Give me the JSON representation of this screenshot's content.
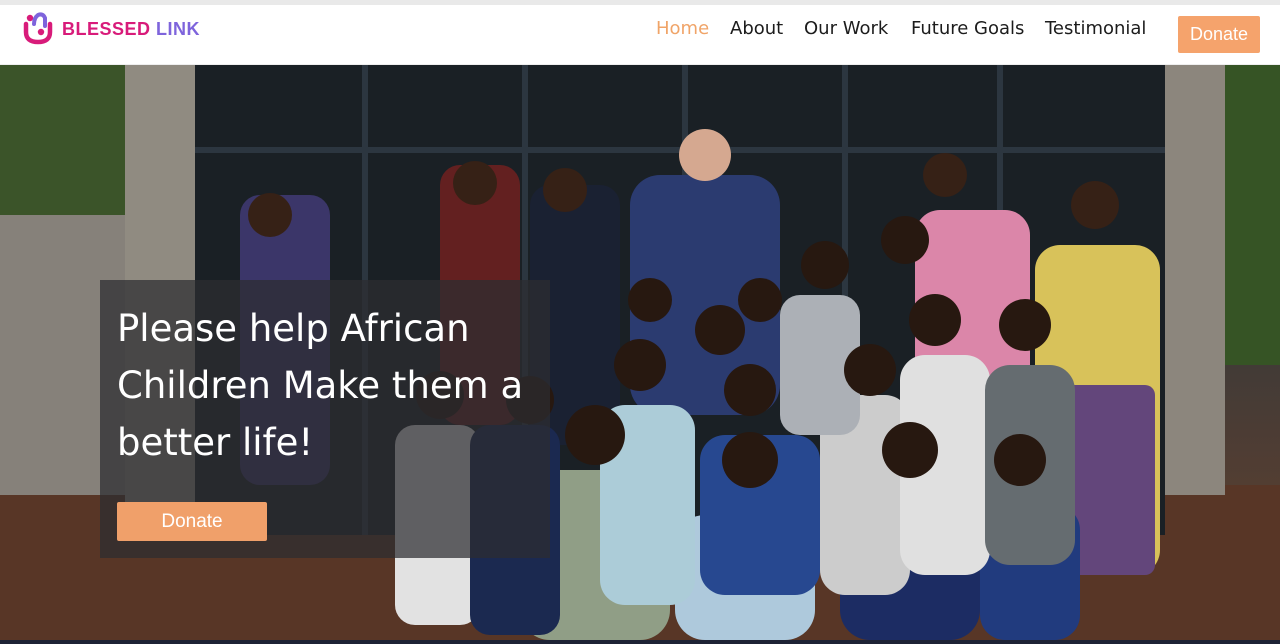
{
  "brand": {
    "name_part1": "BLESSED",
    "name_part2": "LINK",
    "logo_icon": "people-circle-logo",
    "colors": {
      "magenta": "#d81b7a",
      "purple": "#7e64dc"
    }
  },
  "nav": {
    "items": [
      {
        "label": "Home",
        "active": true
      },
      {
        "label": "About",
        "active": false
      },
      {
        "label": "Our Work",
        "active": false
      },
      {
        "label": "Future Goals",
        "active": false
      },
      {
        "label": "Testimonial",
        "active": false
      }
    ],
    "donate_label": "Donate",
    "accent_color": "#f5a36c"
  },
  "hero": {
    "heading": "Please help African Children Make them a better life!",
    "donate_label": "Donate",
    "image_icon": "group-photo-children"
  }
}
